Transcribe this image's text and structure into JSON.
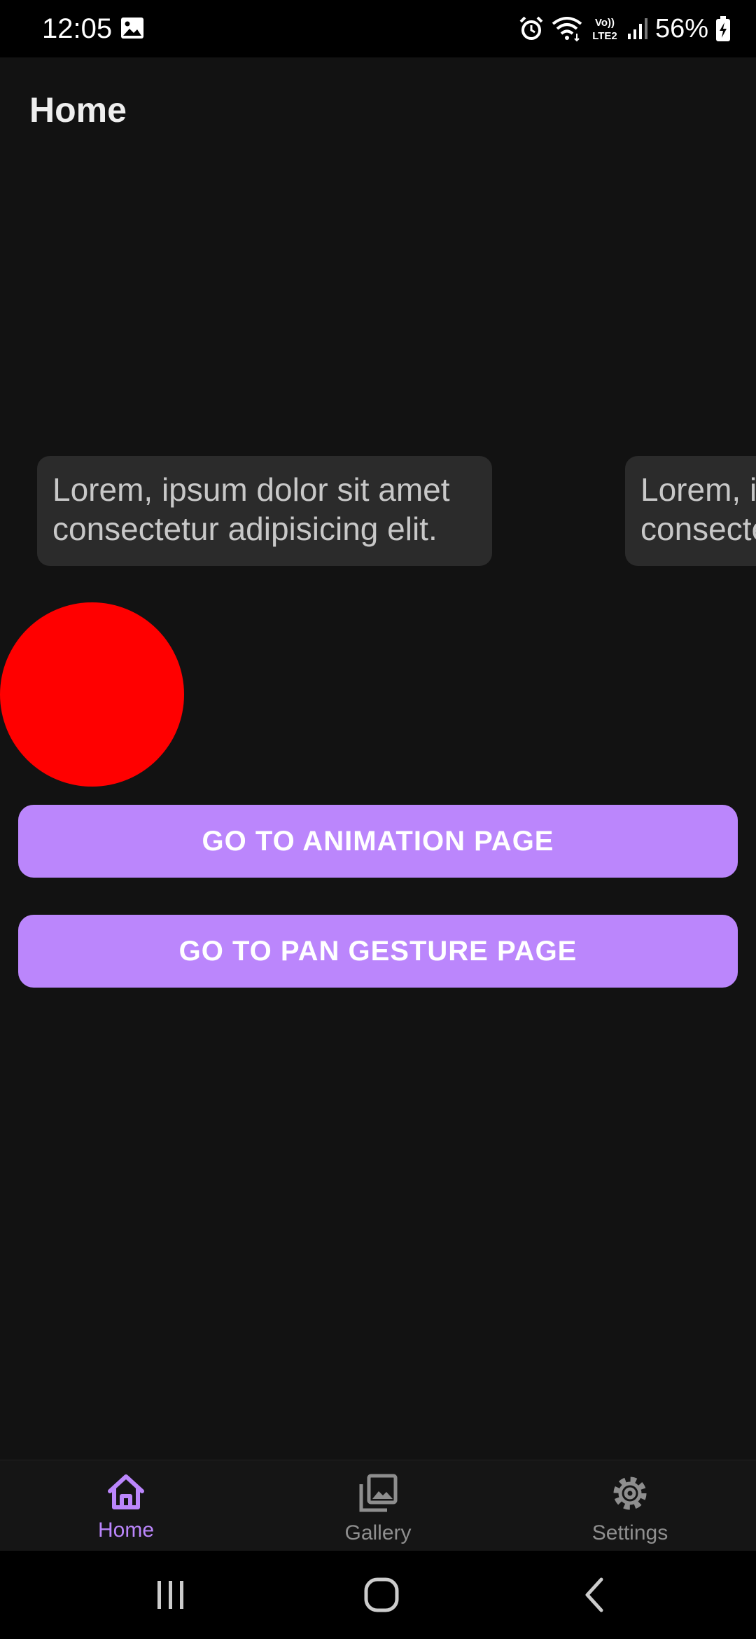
{
  "status_bar": {
    "time": "12:05",
    "network_label": "Vo)) LTE2",
    "battery_percent": "56%",
    "icons": [
      "image-icon",
      "alarm-icon",
      "wifi-icon",
      "volte-icon",
      "signal-icon",
      "battery-charging-icon"
    ]
  },
  "header": {
    "title": "Home"
  },
  "carousel": {
    "cards": [
      {
        "line1": "Lorem, ipsum dolor sit amet",
        "line2": "consectetur adipisicing elit."
      },
      {
        "line1": "Lorem, ipsum dolor sit amet",
        "line2": "consectetur adipisicing elit."
      }
    ]
  },
  "circle": {
    "color": "#ff0000"
  },
  "buttons": {
    "animation_label": "GO TO ANIMATION PAGE",
    "pan_gesture_label": "GO TO PAN GESTURE PAGE",
    "color": "#bb86fc"
  },
  "bottom_nav": {
    "items": [
      {
        "label": "Home",
        "icon": "home-icon",
        "active": true
      },
      {
        "label": "Gallery",
        "icon": "gallery-icon",
        "active": false
      },
      {
        "label": "Settings",
        "icon": "gear-icon",
        "active": false
      }
    ],
    "active_color": "#bb86fc",
    "inactive_color": "#8e8e8e"
  },
  "system_nav": {
    "icons": [
      "recents-icon",
      "home-circle-icon",
      "back-icon"
    ]
  }
}
